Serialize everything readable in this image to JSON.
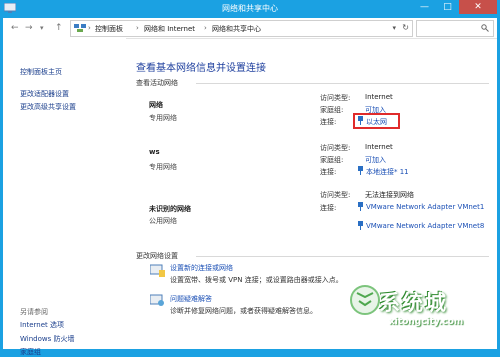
{
  "window": {
    "title": "网络和共享中心"
  },
  "controls": {
    "minimize": "—",
    "maximize": "□",
    "close": "✕"
  },
  "addressbar": {
    "nav_back": "←",
    "nav_forward": "→",
    "nav_up": "↑",
    "crumbs": [
      "控制面板",
      "网络和 Internet",
      "网络和共享中心"
    ],
    "separator": "›"
  },
  "sidebar": {
    "home_link": "控制面板主页",
    "links": [
      "更改适配器设置",
      "更改高级共享设置"
    ],
    "see_also_heading": "另请参阅",
    "see_also": [
      "Internet 选项",
      "Windows 防火墙",
      "家庭组"
    ]
  },
  "main": {
    "title": "查看基本网络信息并设置连接",
    "active_networks_heading": "查看活动网络",
    "labels": {
      "access_type": "访问类型:",
      "homegroup": "家庭组:",
      "connections": "连接:"
    },
    "networks": [
      {
        "name": "网络",
        "type": "专用网络",
        "access": "Internet",
        "homegroup": "可加入",
        "connection": "以太网"
      },
      {
        "name": "ws",
        "type": "专用网络",
        "access": "Internet",
        "homegroup": "可加入",
        "connection": "本地连接* 11"
      },
      {
        "name": "未识别的网络",
        "type": "公用网络",
        "access": "无法连接到网络",
        "connections": [
          "VMware Network Adapter VMnet1",
          "VMware Network Adapter VMnet8"
        ]
      }
    ],
    "change_settings_heading": "更改网络设置",
    "tasks": [
      {
        "title": "设置新的连接或网络",
        "desc": "设置宽带、拨号或 VPN 连接；或设置路由器或接入点。"
      },
      {
        "title": "问题疑难解答",
        "desc": "诊断并修复网络问题，或者获得疑难解答信息。"
      }
    ]
  },
  "watermark": {
    "text": "系统城",
    "url": "xitongcity.com"
  },
  "colors": {
    "titlebar": "#1ba1e2",
    "link": "#1a4fb5",
    "close": "#c7504a",
    "highlight": "#e02b2b"
  }
}
